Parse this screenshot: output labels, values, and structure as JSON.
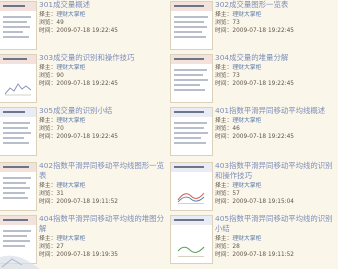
{
  "labels": {
    "author": "择主：",
    "views": "浏览：",
    "time": "时间："
  },
  "cards": [
    {
      "title": "301成交量概述",
      "author": "理财大掌柜",
      "views": "49",
      "time": "2009-07-18 19:22:45"
    },
    {
      "title": "302成交量图形一览表",
      "author": "理财大掌柜",
      "views": "73",
      "time": "2009-07-18 19:22:45"
    },
    {
      "title": "303成交量的识别和操作技巧",
      "author": "理财大掌柜",
      "views": "90",
      "time": "2009-07-18 19:22:45"
    },
    {
      "title": "304成交量的堆量分解",
      "author": "理财大掌柜",
      "views": "73",
      "time": "2009-07-18 19:22:45"
    },
    {
      "title": "305成交量的识别小结",
      "author": "理财大掌柜",
      "views": "70",
      "time": "2009-07-18 19:22:45"
    },
    {
      "title": "401指数平滑异同移动平均线概述",
      "author": "理财大掌柜",
      "views": "46",
      "time": "2009-07-18 19:22:45"
    },
    {
      "title": "402指数平滑异同移动平均线图形一览表",
      "author": "理财大掌柜",
      "views": "31",
      "time": "2009-07-18 19:11:52"
    },
    {
      "title": "403指数平滑异同移动平均线的识别和操作技巧",
      "author": "理财大掌柜",
      "views": "57",
      "time": "2009-07-18 19:15:04"
    },
    {
      "title": "404指数平滑异同移动平均线的堆图分解",
      "author": "理财大掌柜",
      "views": "27",
      "time": "2009-07-18 19:19:35"
    },
    {
      "title": "405指数平滑异同移动平均线的识别小结",
      "author": "理财大掌柜",
      "views": "28",
      "time": "2009-07-18 19:11:52"
    }
  ]
}
